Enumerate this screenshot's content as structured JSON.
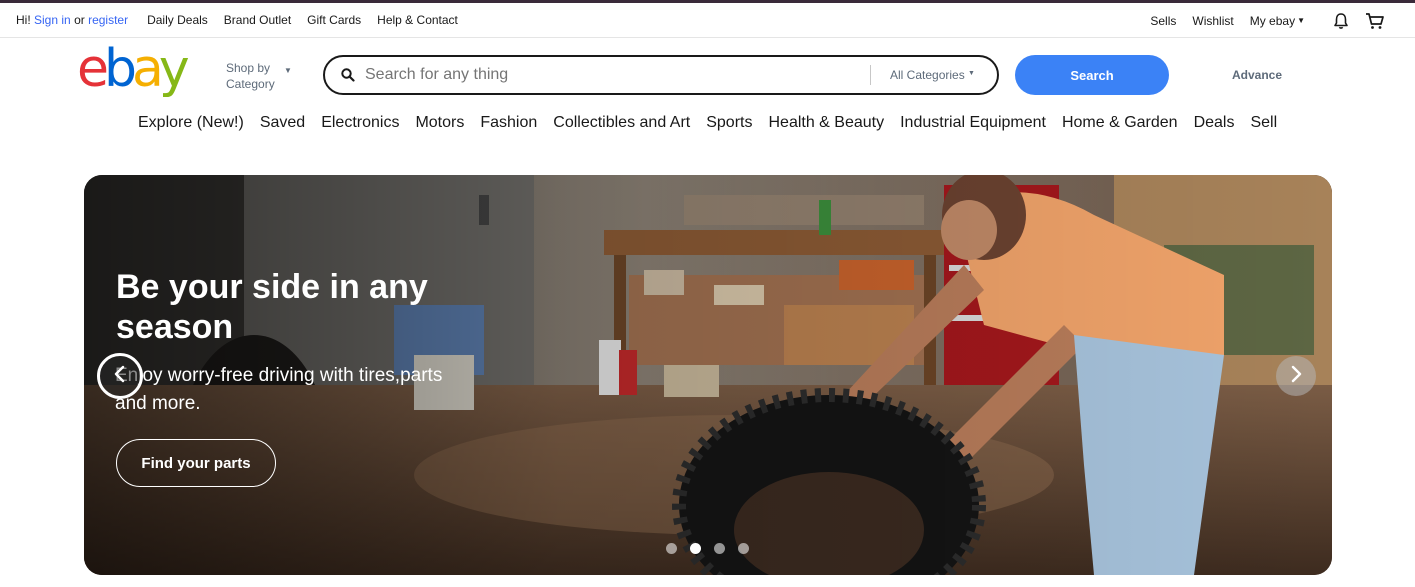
{
  "util": {
    "greeting": "Hi!",
    "sign_in": "Sign in",
    "or": "or",
    "register": "register",
    "links": [
      "Daily Deals",
      "Brand Outlet",
      "Gift Cards",
      "Help & Contact"
    ],
    "sells": "Sells",
    "wishlist": "Wishlist",
    "my_ebay": "My ebay"
  },
  "header": {
    "logo": "ebay",
    "shop_by": "Shop by",
    "category": "Category",
    "search_placeholder": "Search for any thing",
    "all_categories": "All Categories",
    "search_button": "Search",
    "advance": "Advance"
  },
  "nav": [
    "Explore (New!)",
    "Saved",
    "Electronics",
    "Motors",
    "Fashion",
    "Collectibles and Art",
    "Sports",
    "Health & Beauty",
    "Industrial Equipment",
    "Home & Garden",
    "Deals",
    "Sell"
  ],
  "hero": {
    "title": "Be your side in any season",
    "subtitle": "Enjoy worry-free driving with tires,parts and more.",
    "cta": "Find your parts",
    "active_slide": 2,
    "slide_count": 4
  },
  "colors": {
    "accent": "#3b82f6",
    "link": "#3665f3",
    "logo_e": "#e53238",
    "logo_b": "#0064d2",
    "logo_a": "#f5af02",
    "logo_y": "#86b817"
  },
  "icons": [
    "search-icon",
    "bell-icon",
    "cart-icon",
    "chevron-left-icon",
    "chevron-right-icon"
  ]
}
